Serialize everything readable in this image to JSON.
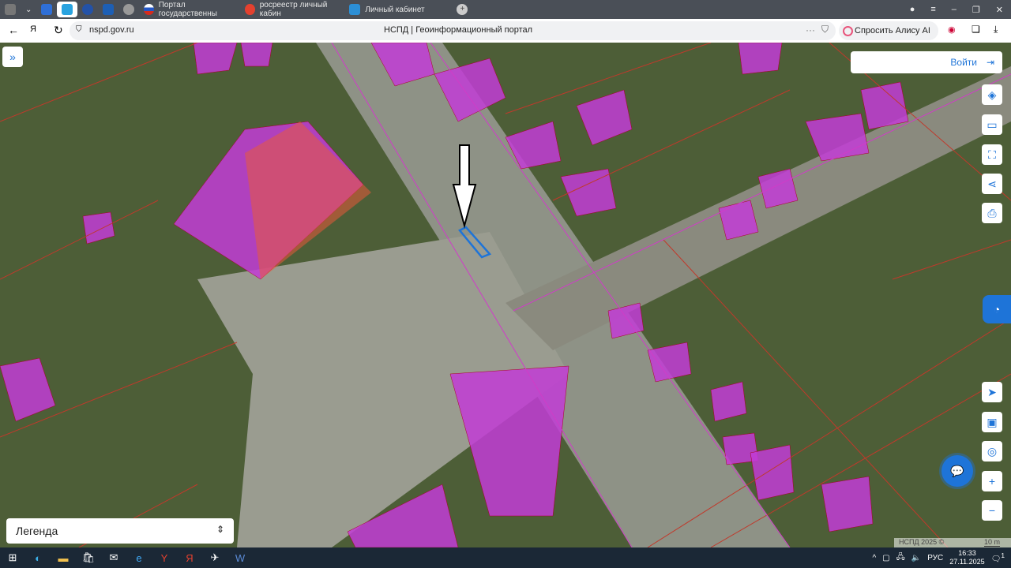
{
  "browser": {
    "tabs": [
      {
        "label": "Портал государственны",
        "icon": "gosuslugi-icon"
      },
      {
        "label": "росреестр личный кабин",
        "icon": "yandex-icon"
      },
      {
        "label": "Личный кабинет",
        "icon": "rosreestr-icon"
      }
    ],
    "url": "nspd.gov.ru",
    "page_title": "НСПД | Геоинформационный портал",
    "alice_label": "Спросить Алису AI"
  },
  "map": {
    "login_label": "Войти",
    "legend_label": "Легенда",
    "attribution": "НСПД 2025 ©",
    "scale": "10 m",
    "colors": {
      "building": "#c23cd6",
      "parcel_border": "#c0392b",
      "selected": "#1e74d8"
    }
  },
  "taskbar": {
    "lang": "РУС",
    "time": "16:33",
    "date": "27.11.2025",
    "notifications": "1"
  }
}
